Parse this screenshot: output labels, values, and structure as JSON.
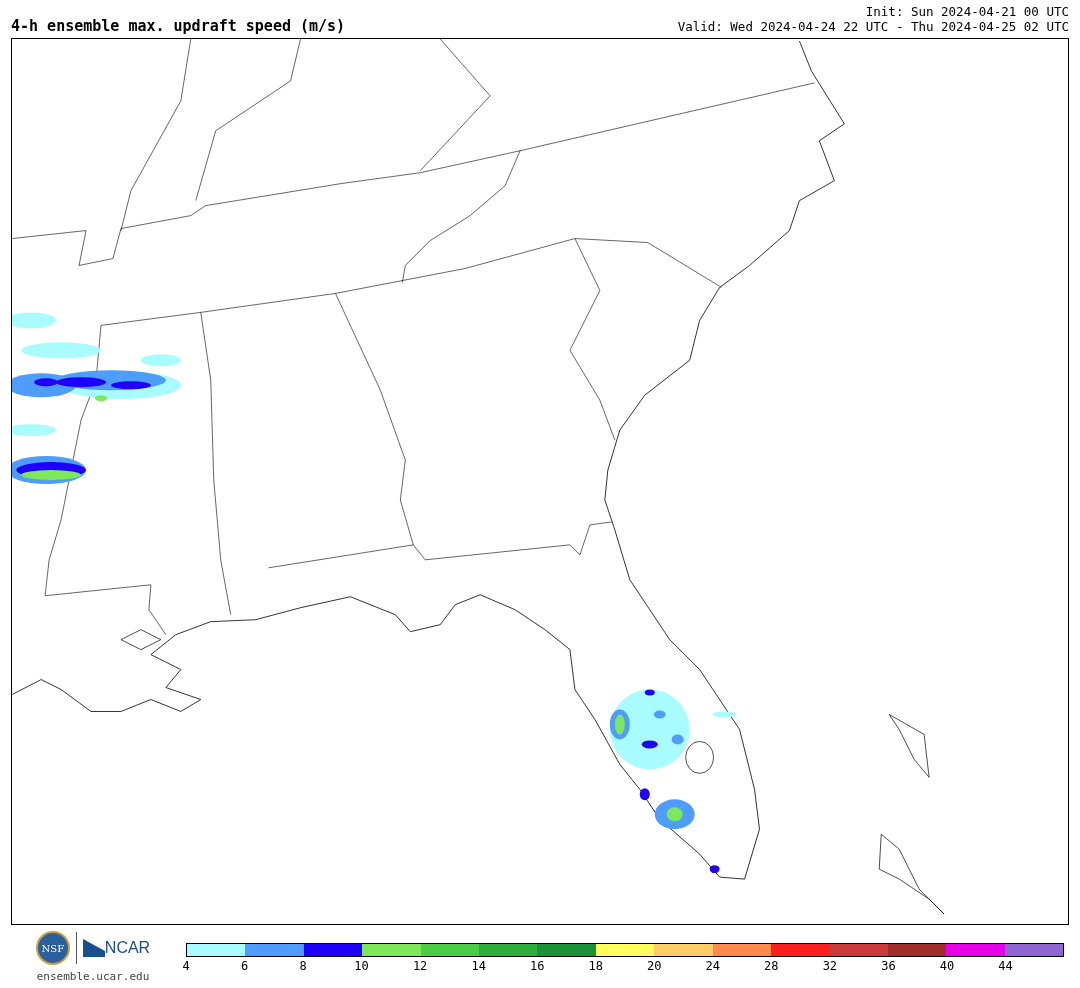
{
  "title": "4-h ensemble max. updraft speed (m/s)",
  "init": "Init: Sun 2024-04-21 00 UTC",
  "valid": "Valid: Wed 2024-04-24 22 UTC - Thu 2024-04-25 02 UTC",
  "logos": {
    "nsf": "NSF",
    "ncar": "NCAR",
    "url": "ensemble.ucar.edu"
  },
  "colorbar": {
    "segments": [
      {
        "color": "#a8fcff"
      },
      {
        "color": "#4e9cfc"
      },
      {
        "color": "#1e00fc"
      },
      {
        "color": "#7ce85a"
      },
      {
        "color": "#4ccc46"
      },
      {
        "color": "#2eae3a"
      },
      {
        "color": "#1c9238"
      },
      {
        "color": "#ffff5e"
      },
      {
        "color": "#ffcc66"
      },
      {
        "color": "#ff8a4c"
      },
      {
        "color": "#fe1e1e"
      },
      {
        "color": "#ca3a3a"
      },
      {
        "color": "#a02c2c"
      },
      {
        "color": "#e800e8"
      },
      {
        "color": "#8e66d2"
      }
    ],
    "ticks": [
      "4",
      "6",
      "8",
      "10",
      "12",
      "14",
      "16",
      "18",
      "20",
      "24",
      "28",
      "32",
      "36",
      "40",
      "44"
    ]
  }
}
